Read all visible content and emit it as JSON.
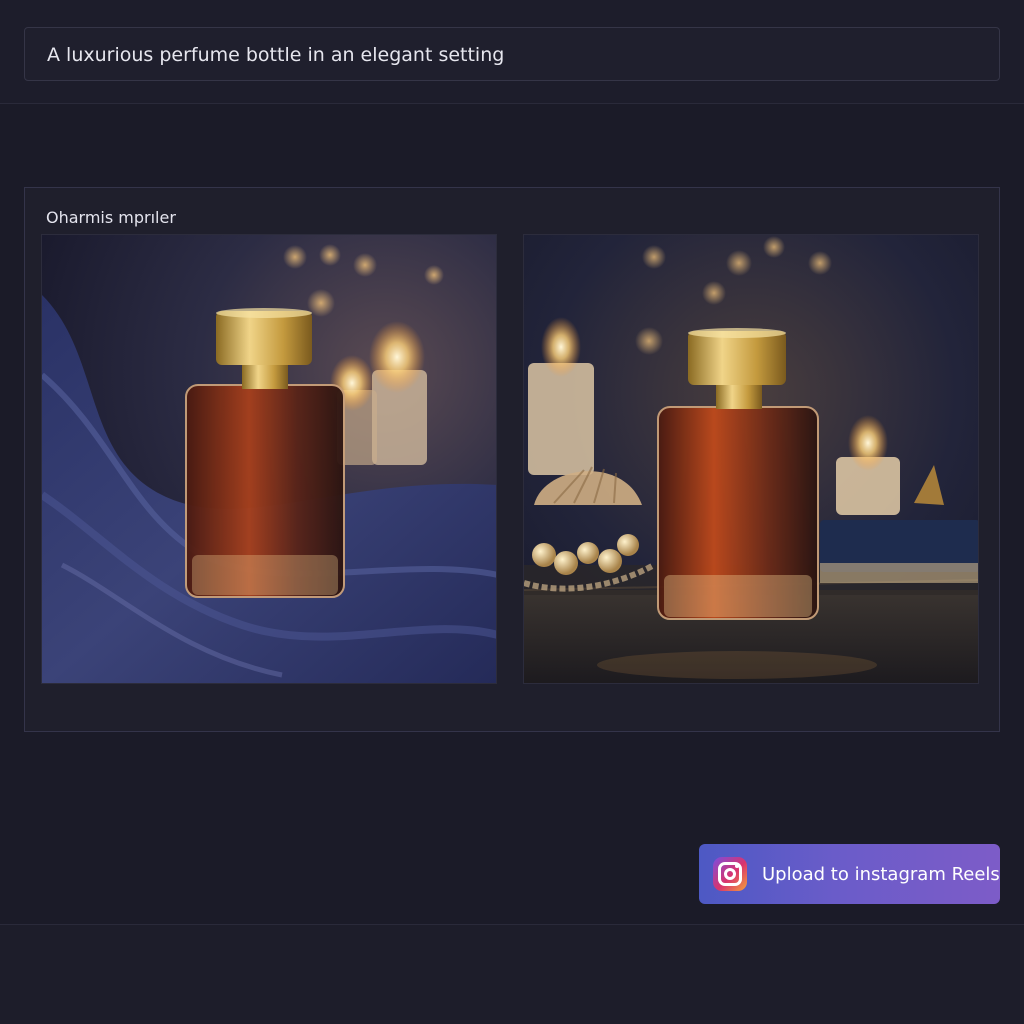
{
  "prompt": {
    "text": "A luxurious perfume bottle in an elegant setting"
  },
  "gallery": {
    "title": "Oharmis mprıler",
    "images": [
      {
        "alt": "Perfume bottle with gold cap on blue silk with candles"
      },
      {
        "alt": "Perfume bottle with gold cap beside seashell, pearls, candles and a book"
      }
    ]
  },
  "actions": {
    "upload_label": "Upload to instagram Reels",
    "upload_icon": "instagram-icon"
  },
  "colors": {
    "background": "#1b1b28",
    "button_gradient_start": "#4d59c4",
    "button_gradient_end": "#7d5cc8"
  }
}
